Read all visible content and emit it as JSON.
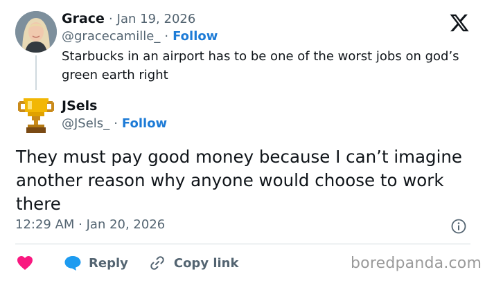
{
  "parent_tweet": {
    "author_name": "Grace",
    "date": "Jan 19, 2026",
    "handle": "@gracecamille_",
    "follow_label": "Follow",
    "text": "Starbucks in an airport has to be one of the worst jobs on god’s green earth right"
  },
  "reply_tweet": {
    "author_name": "JSels",
    "handle": "@JSels_",
    "follow_label": "Follow",
    "text": "They must pay good money because I can’t imagine another reason why anyone would choose to work there",
    "timestamp": "12:29 AM · Jan 20, 2026"
  },
  "separator": "·",
  "actions": {
    "reply_label": "Reply",
    "copy_link_label": "Copy link"
  },
  "icons": {
    "platform_logo": "x-logo-icon",
    "like": "heart-icon",
    "reply": "speech-bubble-icon",
    "copy_link": "link-icon",
    "info": "info-icon",
    "reply_avatar": "trophy-icon"
  },
  "colors": {
    "follow_blue": "#1d7bd6",
    "like_pink": "#f91880",
    "reply_blue": "#1d9bf0",
    "muted_gray": "#536471"
  },
  "watermark": "boredpanda.com"
}
